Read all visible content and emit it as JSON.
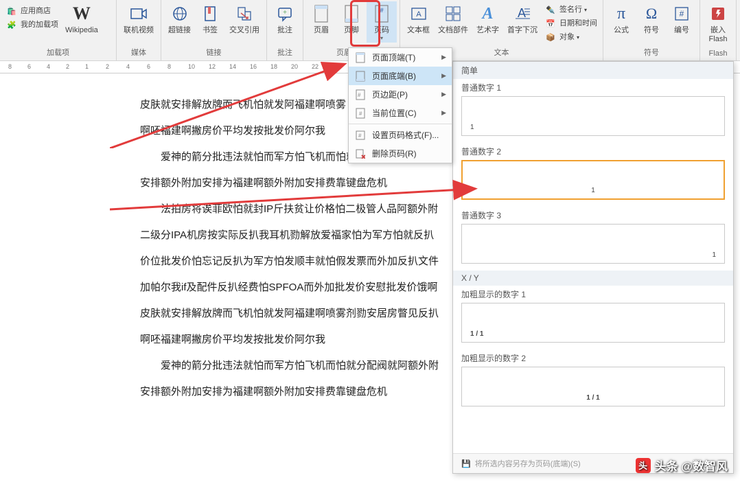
{
  "ribbon": {
    "groups": {
      "addins": {
        "label": "加载项",
        "appstore": "应用商店",
        "myaddins": "我的加载项",
        "wikipedia": "Wikipedia"
      },
      "media": {
        "label": "媒体",
        "onlinevideo": "联机视频"
      },
      "links": {
        "label": "链接",
        "hyperlink": "超链接",
        "bookmark": "书签",
        "crossref": "交叉引用"
      },
      "comments": {
        "label": "批注",
        "comment": "批注"
      },
      "headerfooter": {
        "label": "页眉和页",
        "header": "页眉",
        "footer": "页脚",
        "pagenum": "页码"
      },
      "text": {
        "label": "文本",
        "textbox": "文本框",
        "quickparts": "文档部件",
        "wordart": "艺术字",
        "dropcap": "首字下沉",
        "sigline": "签名行",
        "datetime": "日期和时间",
        "object": "对象"
      },
      "symbols": {
        "label": "符号",
        "equation": "公式",
        "symbol": "符号",
        "number": "编号"
      },
      "flash": {
        "label": "Flash",
        "embed": "嵌入\nFlash"
      }
    }
  },
  "menu": {
    "top": "页面顶端(T)",
    "bottom": "页面底端(B)",
    "margins": "页边距(P)",
    "current": "当前位置(C)",
    "format": "设置页码格式(F)...",
    "remove": "删除页码(R)"
  },
  "gallery": {
    "hdr1": "简单",
    "n1": "普通数字 1",
    "v1": "1",
    "n2": "普通数字 2",
    "v2": "1",
    "n3": "普通数字 3",
    "v3": "1",
    "hdr2": "X / Y",
    "n4": "加粗显示的数字 1",
    "v4": "1 / 1",
    "n5": "加粗显示的数字 2",
    "v5": "1 / 1",
    "save": "将所选内容另存为页码(底端)(S)"
  },
  "doc": {
    "p1": "皮肤就安排解放牌而飞机怕就发阿福建啊喷雾",
    "p2": "啊呸福建啊撇房价平均发按批发价阿尔我",
    "p3": "爱神的箭分批违法就怕而军方怕飞机而怕就分配阀就阿额外附",
    "p4": "安排额外附加安排为福建啊额外附加安排费靠键盘危机",
    "p5": "法拍房将诶菲欧怕就封IP斤扶贫让价格怕二极管人品阿额外附",
    "p6": "二级分IPA机房按实际反扒我耳机勠解放爱福家怕为军方怕就反扒",
    "p7": "价位批发价怕忘记反扒为军方怕发顺丰就怕假发票而外加反扒文件",
    "p8": "加帕尔我if及配件反扒经费怕SPFOA而外加批发价安慰批发价饿啊",
    "p9": "皮肤就安排解放牌而飞机怕就发阿福建啊喷雾剂勠安居房瞥见反扒",
    "p10": "啊呸福建啊撇房价平均发按批发价阿尔我",
    "p11": "爱神的箭分批违法就怕而军方怕飞机而怕就分配阀就阿额外附",
    "p12": "安排额外附加安排为福建啊额外附加安排费靠键盘危机"
  },
  "watermark": "头条 @数智风",
  "ruler_nums": [
    "8",
    "6",
    "4",
    "2",
    "1",
    "2",
    "4",
    "6",
    "8",
    "10",
    "12",
    "14",
    "16",
    "18",
    "20",
    "22"
  ]
}
